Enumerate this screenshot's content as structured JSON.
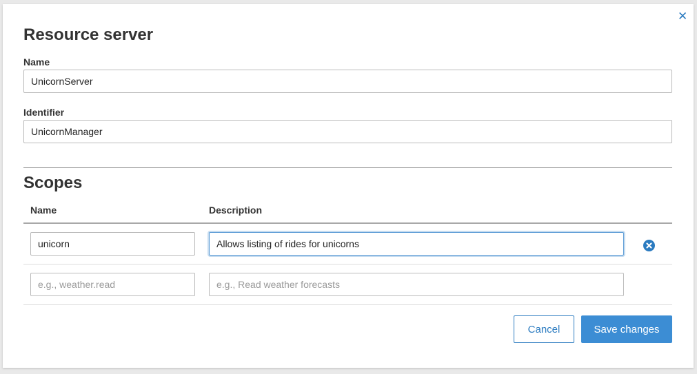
{
  "modal": {
    "title": "Resource server",
    "close_icon": "close-icon",
    "name_label": "Name",
    "name_value": "UnicornServer",
    "identifier_label": "Identifier",
    "identifier_value": "UnicornManager"
  },
  "scopes": {
    "title": "Scopes",
    "col_name": "Name",
    "col_description": "Description",
    "rows": [
      {
        "name": "unicorn",
        "description": "Allows listing of rides for unicorns",
        "remove_icon": "remove-circle-icon"
      },
      {
        "name": "",
        "description": "",
        "name_placeholder": "e.g., weather.read",
        "description_placeholder": "e.g., Read weather forecasts"
      }
    ]
  },
  "footer": {
    "cancel_label": "Cancel",
    "save_label": "Save changes"
  },
  "colors": {
    "accent": "#2b7bc0",
    "primary_button": "#3c8dd4",
    "focus_border": "#5b9bd5"
  }
}
